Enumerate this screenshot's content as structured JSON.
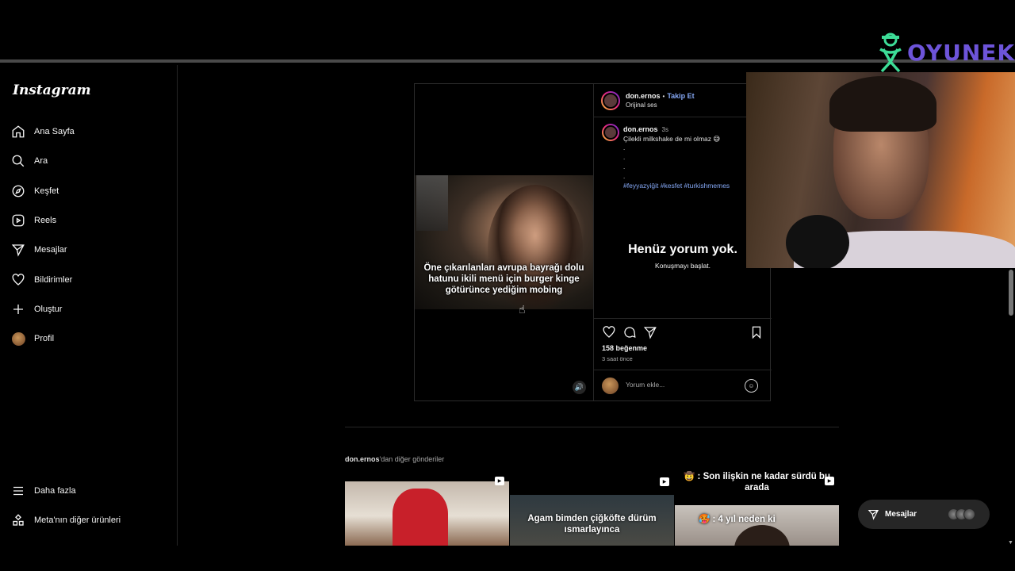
{
  "overlay": {
    "logo_text": "OYUNEKS"
  },
  "sidebar": {
    "brand": "Instagram",
    "items": [
      {
        "label": "Ana Sayfa",
        "icon": "home-icon"
      },
      {
        "label": "Ara",
        "icon": "search-icon"
      },
      {
        "label": "Keşfet",
        "icon": "compass-icon"
      },
      {
        "label": "Reels",
        "icon": "reels-icon"
      },
      {
        "label": "Mesajlar",
        "icon": "messages-icon"
      },
      {
        "label": "Bildirimler",
        "icon": "heart-icon"
      },
      {
        "label": "Oluştur",
        "icon": "plus-icon"
      },
      {
        "label": "Profil",
        "icon": "avatar"
      }
    ],
    "bottom": [
      {
        "label": "Daha fazla",
        "icon": "menu-icon"
      },
      {
        "label": "Meta'nın diğer ürünleri",
        "icon": "meta-products-icon"
      }
    ]
  },
  "post": {
    "video_caption": "Öne çıkarılanları avrupa bayrağı dolu hatunu ikili menü için burger kinge götürünce yediğim mobing",
    "author": "don.ernos",
    "separator": "•",
    "follow_label": "Takip Et",
    "audio": "Orijinal ses",
    "caption_user": "don.ernos",
    "caption_time": "3s",
    "caption_text": "Çilekli milkshake de mi olmaz 😅",
    "caption_dots": [
      ".",
      ".",
      ".",
      "."
    ],
    "hashtags": "#feyyazyiğit #kesfet #turkishmemes",
    "empty_title": "Henüz yorum yok.",
    "empty_sub": "Konuşmayı başlat.",
    "likes": "158 beğenme",
    "time_ago": "3 saat önce",
    "comment_placeholder": "Yorum ekle..."
  },
  "more_posts": {
    "user": "don.ernos",
    "suffix": "'dan diğer gönderiler",
    "thumbs": [
      {
        "text": ""
      },
      {
        "text": "Agam bimden çiğköfte dürüm ısmarlayınca"
      },
      {
        "text": "🤠 : Son ilişkin ne kadar sürdü bu arada",
        "text2": "🥵 : 4 yıl neden ki"
      }
    ]
  },
  "dm_bar": {
    "label": "Mesajlar"
  }
}
